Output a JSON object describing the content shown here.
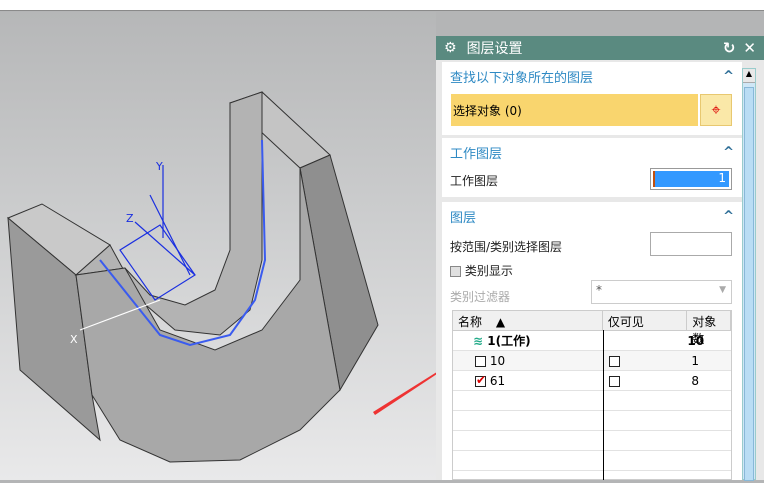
{
  "dialog": {
    "title": "图层设置",
    "gear_icon": "gear-icon",
    "reset_icon": "reset-icon",
    "close_icon": "close-icon"
  },
  "find_section": {
    "title": "查找以下对象所在的图层",
    "select_label": "选择对象 (0)"
  },
  "work_section": {
    "title": "工作图层",
    "label": "工作图层",
    "value": "1"
  },
  "layer_section": {
    "title": "图层",
    "range_label": "按范围/类别选择图层",
    "category_display": "类别显示",
    "category_filter_label": "类别过滤器",
    "category_filter_value": "*",
    "columns": [
      "名称",
      "仅可见",
      "对象数"
    ],
    "rows": [
      {
        "name": "1(工作)",
        "visible": "",
        "count": "10"
      },
      {
        "name": "10",
        "visible": "",
        "count": "1"
      },
      {
        "name": "61",
        "visible": "",
        "count": "8"
      }
    ]
  },
  "axes": {
    "x": "X",
    "y": "Y",
    "z": "Z"
  },
  "colors": {
    "titlebar": "#5a8a80",
    "accent": "#2f8ac4",
    "select_bg": "#f9d56e",
    "highlight": "#3399ff"
  }
}
